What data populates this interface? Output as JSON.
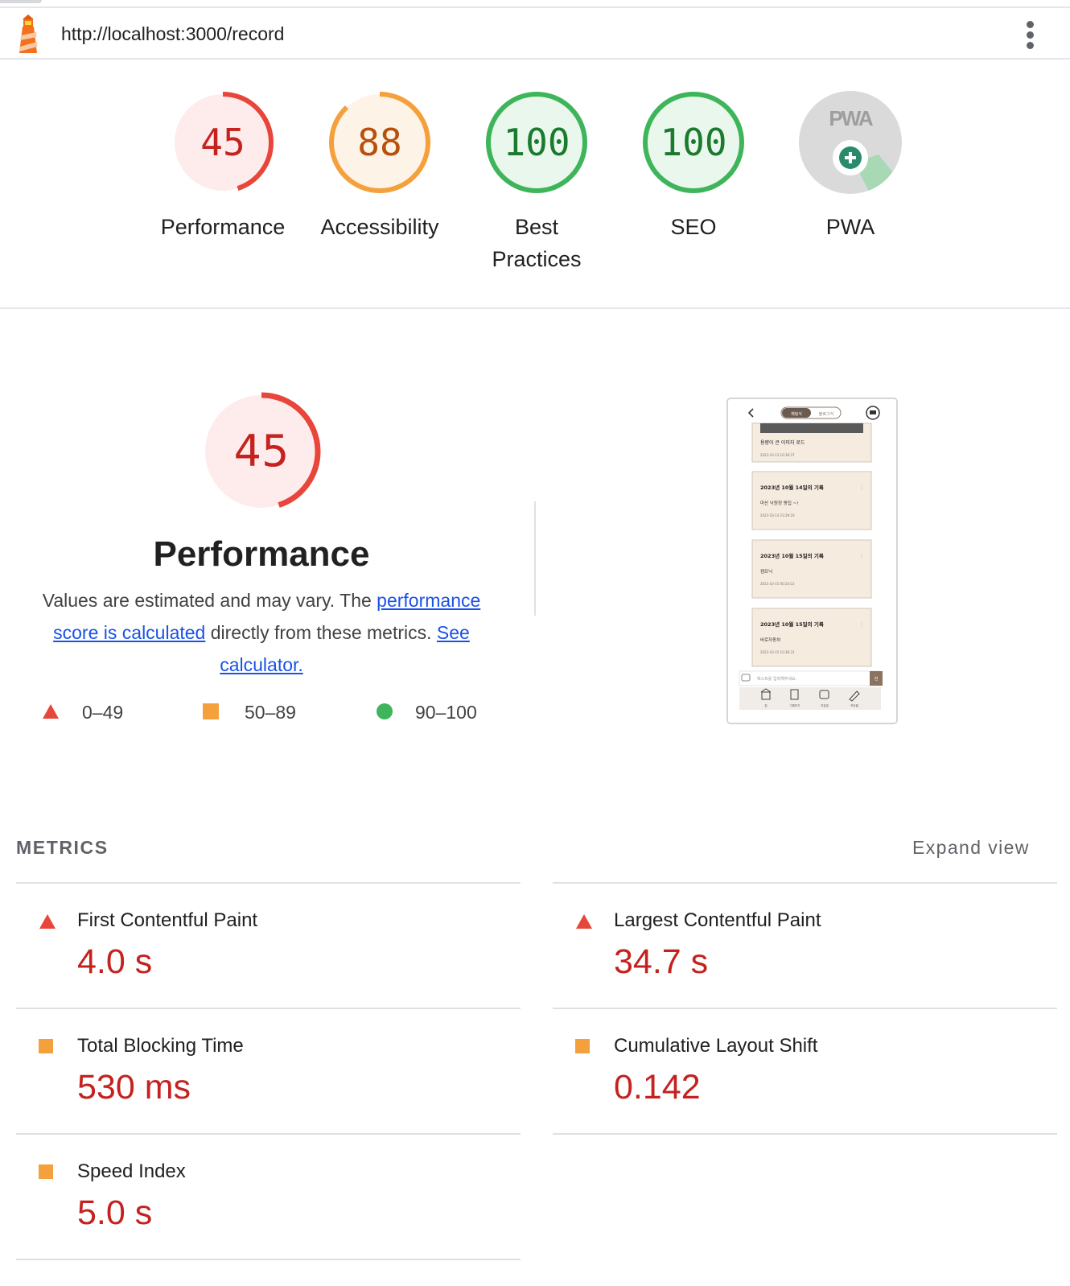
{
  "header": {
    "url": "http://localhost:3000/record"
  },
  "gauges": [
    {
      "score": "45",
      "label": "Performance",
      "color": "#e8463a",
      "fill": "#fdeceb",
      "fraction": 0.45
    },
    {
      "score": "88",
      "label": "Accessibility",
      "color": "#f4a03c",
      "fill": "#fdf3e6",
      "fraction": 0.88
    },
    {
      "score": "100",
      "label": "Best Practices",
      "color": "#3eb55a",
      "fill": "#eaf7ed",
      "fraction": 1.0
    },
    {
      "score": "100",
      "label": "SEO",
      "color": "#3eb55a",
      "fill": "#eaf7ed",
      "fraction": 1.0
    },
    {
      "badge": "PWA",
      "label": "PWA",
      "color": "#c8c8c8"
    }
  ],
  "performance": {
    "score": "45",
    "fraction": 0.45,
    "title": "Performance",
    "desc_prefix": "Values are estimated and may vary. The ",
    "link1": "performance score is calculated",
    "desc_middle": " directly from these metrics. ",
    "link2": "See calculator."
  },
  "legend": [
    {
      "shape": "triangle",
      "range": "0–49",
      "color": "#e8463a"
    },
    {
      "shape": "square",
      "range": "50–89",
      "color": "#f4a03c"
    },
    {
      "shape": "circle",
      "range": "90–100",
      "color": "#3eb55a"
    }
  ],
  "screenshot": {
    "tab_active": "채팅식",
    "tab_inactive": "블로그식",
    "cards": [
      {
        "caption": "용량이 큰 이미지 로드",
        "date": "2023-10-13 10:36:37"
      },
      {
        "title": "2023년 10월 14일의 기록",
        "body": "마산 낙원정 짱집 ~!",
        "date": "2023-10-14 23:29:19"
      },
      {
        "title": "2023년 10월 15일의 기록",
        "body": "캠프닉",
        "date": "2023-10-15 00:24:22"
      },
      {
        "title": "2023년 10월 15일의 기록",
        "body": "바로자동차",
        "date": "2023-10-15 10:36:31"
      }
    ],
    "input_placeholder": "텍스트를 입력해주세요.",
    "send": "전",
    "nav": [
      "집",
      "기록보기",
      "지갑링",
      "프로필"
    ]
  },
  "metrics": {
    "title": "METRICS",
    "expand": "Expand view",
    "items": [
      {
        "name": "First Contentful Paint",
        "value": "4.0 s",
        "rating": "triangle"
      },
      {
        "name": "Largest Contentful Paint",
        "value": "34.7 s",
        "rating": "triangle"
      },
      {
        "name": "Total Blocking Time",
        "value": "530 ms",
        "rating": "square"
      },
      {
        "name": "Cumulative Layout Shift",
        "value": "0.142",
        "rating": "square"
      },
      {
        "name": "Speed Index",
        "value": "5.0 s",
        "rating": "square"
      }
    ]
  },
  "colors": {
    "fail": "#e8463a",
    "average": "#f4a03c",
    "pass": "#3eb55a",
    "fail_text": "#c5221f",
    "average_text": "#b8500d",
    "pass_text": "#1a7a2e",
    "link": "#1a52e6"
  }
}
